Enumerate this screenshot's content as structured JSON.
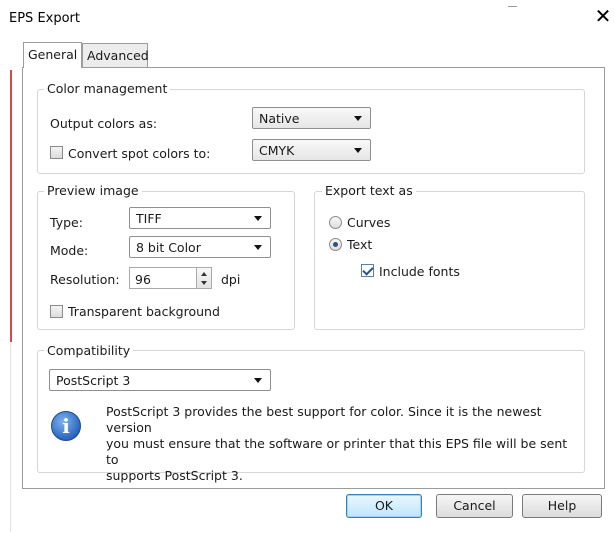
{
  "window": {
    "title": "EPS Export",
    "close_glyph": "✕"
  },
  "tabs": [
    {
      "label": "General",
      "active": true
    },
    {
      "label": "Advanced",
      "active": false
    }
  ],
  "color_management": {
    "legend": "Color management",
    "output_colors_label": "Output colors as:",
    "output_colors_value": "Native",
    "convert_spot_label": "Convert spot colors to:",
    "convert_spot_checked": false,
    "convert_spot_value": "CMYK"
  },
  "preview_image": {
    "legend": "Preview image",
    "type_label": "Type:",
    "type_value": "TIFF",
    "mode_label": "Mode:",
    "mode_value": "8 bit Color",
    "resolution_label": "Resolution:",
    "resolution_value": "96",
    "resolution_unit": "dpi",
    "transparent_label": "Transparent background",
    "transparent_checked": false
  },
  "export_text": {
    "legend": "Export text as",
    "curves_label": "Curves",
    "text_label": "Text",
    "selected": "Text",
    "include_fonts_label": "Include fonts",
    "include_fonts_checked": true
  },
  "compatibility": {
    "legend": "Compatibility",
    "value": "PostScript 3",
    "info_glyph": "i",
    "info_lines": [
      "PostScript 3 provides the best support for color. Since it is the newest version",
      "you must ensure that the software or printer that this EPS file will be sent to",
      "supports PostScript 3."
    ]
  },
  "buttons": {
    "ok": "OK",
    "cancel": "Cancel",
    "help": "Help"
  },
  "icons": {
    "close": "close-icon",
    "info": "info-icon",
    "dropdown": "chevron-down-icon"
  }
}
